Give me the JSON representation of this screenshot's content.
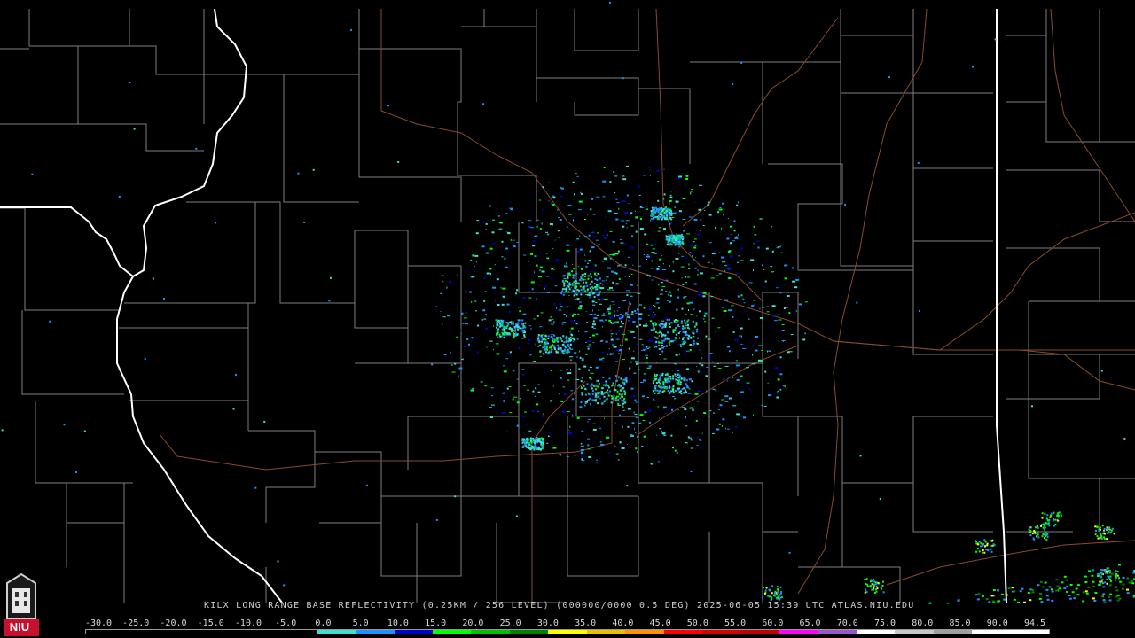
{
  "caption": "KILX LONG RANGE BASE REFLECTIVITY (0.25KM / 256 LEVEL) (000000/0000 0.5 DEG) 2025-06-05 15:39 UTC  ATLAS.NIU.EDU",
  "logo_text": "NIU",
  "logo_icon": "university-tower-icon",
  "colors": {
    "background": "#000000",
    "county_lines": "#8c8c8c",
    "state_lines": "#ffffff",
    "highways": "#8a4a2c",
    "logo_red": "#c8102e"
  },
  "scale": {
    "labels": [
      "-30.0",
      "-25.0",
      "-20.0",
      "-15.0",
      "-10.0",
      "-5.0",
      "0.0",
      "5.0",
      "10.0",
      "15.0",
      "20.0",
      "25.0",
      "30.0",
      "35.0",
      "40.0",
      "45.0",
      "50.0",
      "55.0",
      "60.0",
      "65.0",
      "70.0",
      "75.0",
      "80.0",
      "85.0",
      "90.0",
      "94.5"
    ],
    "colors": [
      "#000000",
      "#000000",
      "#000000",
      "#000000",
      "#000000",
      "#000000",
      "#40e0d0",
      "#1e90ff",
      "#0000cd",
      "#00ff00",
      "#00c000",
      "#008000",
      "#ffff00",
      "#e7c000",
      "#ff9000",
      "#ff0000",
      "#d60000",
      "#c00000",
      "#ff00ff",
      "#9955c9",
      "#ffffff",
      "#c8c8c8",
      "#a0a0a0",
      "#ffffff",
      "#ffffff"
    ]
  }
}
